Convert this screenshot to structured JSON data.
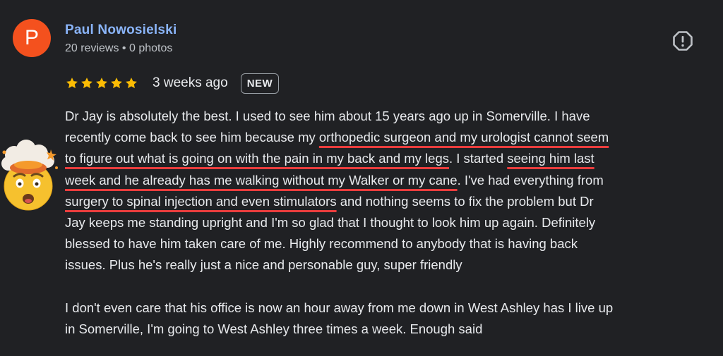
{
  "reviewer": {
    "initial": "P",
    "name": "Paul Nowosielski",
    "meta": "20 reviews • 0 photos",
    "avatar_color": "#f4511e"
  },
  "rating": {
    "stars": 5,
    "time": "3 weeks ago",
    "badge": "NEW",
    "star_color": "#fbbc04"
  },
  "actions": {
    "flag_icon": "report-flag-icon"
  },
  "review": {
    "lines": [
      [
        {
          "t": "Dr Jay is absolutely the best. I used to see him about 15 years ago up in Somerville. I have",
          "u": false
        }
      ],
      [
        {
          "t": "recently come back to see him because my ",
          "u": false
        },
        {
          "t": "orthopedic surgeon and my urologist cannot seem",
          "u": true
        }
      ],
      [
        {
          "t": "to figure out what is going on with the pain in my back and my legs",
          "u": true
        },
        {
          "t": ". I started ",
          "u": false
        },
        {
          "t": "seeing him last",
          "u": true
        }
      ],
      [
        {
          "t": "week and he already has me walking without my Walker or my cane",
          "u": true
        },
        {
          "t": ". I've had everything from",
          "u": false
        }
      ],
      [
        {
          "t": "surgery to spinal injection and even stimulators",
          "u": true
        },
        {
          "t": " and nothing seems to fix the problem but Dr",
          "u": false
        }
      ],
      [
        {
          "t": "Jay keeps me standing upright and I'm so glad that I thought to look him up again. Definitely",
          "u": false
        }
      ],
      [
        {
          "t": "blessed to have him taken care of me. Highly recommend to anybody that is having back",
          "u": false
        }
      ],
      [
        {
          "t": "issues. Plus he's really just a nice and personable guy, super friendly",
          "u": false
        }
      ],
      [],
      [
        {
          "t": "I don't even care that his office is now an hour away from me down in West Ashley has I live up",
          "u": false
        }
      ],
      [
        {
          "t": "in Somerville, I'm going to West Ashley three times a week. Enough said",
          "u": false
        }
      ]
    ],
    "highlight_color": "#ea3d3d"
  },
  "sticker": {
    "icon": "mind-blown-emoji-icon"
  }
}
